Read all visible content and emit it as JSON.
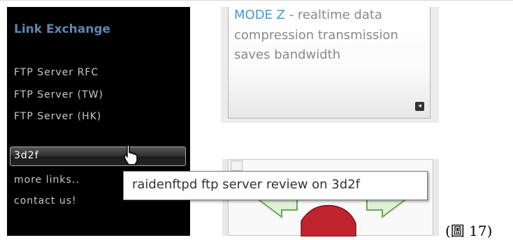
{
  "sidebar": {
    "heading": "Link Exchange",
    "items": [
      {
        "label": "FTP Server RFC"
      },
      {
        "label": "FTP Server (TW)"
      },
      {
        "label": "FTP Server (HK)"
      },
      {
        "label": "3d2f",
        "active": true
      },
      {
        "label": "more links.."
      },
      {
        "label": "contact us!"
      }
    ]
  },
  "feature": {
    "link_text": "MODE Z",
    "description": " - realtime data compression transmission saves bandwidth",
    "expand_icon": "expand-icon"
  },
  "tooltip": {
    "text": "raidenftpd ftp server review on 3d2f"
  },
  "caption": "(圖 17)",
  "colors": {
    "sidebar_bg": "#000000",
    "heading": "#5f86b1",
    "link": "#3d9bd6",
    "feature_text": "#8a8a8a"
  }
}
